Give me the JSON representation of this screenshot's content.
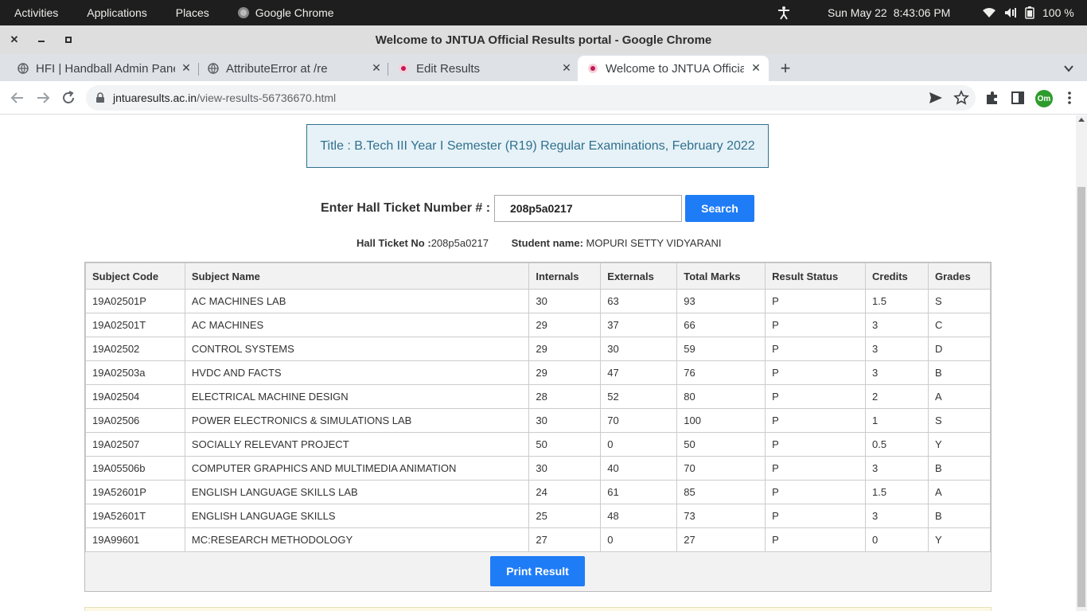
{
  "system_bar": {
    "activities": "Activities",
    "applications": "Applications",
    "places": "Places",
    "app_name": "Google Chrome",
    "date": "Sun May 22",
    "time": "8:43:06 PM",
    "battery": "100 %"
  },
  "window": {
    "title": "Welcome to JNTUA Official Results portal - Google Chrome"
  },
  "tabs": [
    {
      "label": "HFI | Handball Admin Panel",
      "active": false
    },
    {
      "label": "AttributeError at /re",
      "active": false
    },
    {
      "label": "Edit Results",
      "active": false
    },
    {
      "label": "Welcome to JNTUA Official Results portal",
      "active": true
    }
  ],
  "address_bar": {
    "domain": "jntuaresults.ac.in",
    "path": "/view-results-56736670.html"
  },
  "profile": {
    "initials": "Om",
    "color": "#2e9b2e"
  },
  "page": {
    "title": "Title : B.Tech III Year I Semester (R19) Regular Examinations, February 2022",
    "search_label": "Enter Hall Ticket Number # :",
    "search_value": "208p5a0217",
    "search_button": "Search",
    "hall_ticket_label": "Hall Ticket No :",
    "hall_ticket_value": "208p5a0217",
    "student_label": "Student name:",
    "student_value": "MOPURI SETTY VIDYARANI",
    "print_button": "Print Result",
    "accent_color": "#1f7cf7"
  },
  "results": {
    "headers": [
      "Subject Code",
      "Subject Name",
      "Internals",
      "Externals",
      "Total Marks",
      "Result Status",
      "Credits",
      "Grades"
    ],
    "rows": [
      [
        "19A02501P",
        "AC MACHINES LAB",
        "30",
        "63",
        "93",
        "P",
        "1.5",
        "S"
      ],
      [
        "19A02501T",
        "AC MACHINES",
        "29",
        "37",
        "66",
        "P",
        "3",
        "C"
      ],
      [
        "19A02502",
        "CONTROL SYSTEMS",
        "29",
        "30",
        "59",
        "P",
        "3",
        "D"
      ],
      [
        "19A02503a",
        "HVDC AND FACTS",
        "29",
        "47",
        "76",
        "P",
        "3",
        "B"
      ],
      [
        "19A02504",
        "ELECTRICAL MACHINE DESIGN",
        "28",
        "52",
        "80",
        "P",
        "2",
        "A"
      ],
      [
        "19A02506",
        "POWER ELECTRONICS & SIMULATIONS LAB",
        "30",
        "70",
        "100",
        "P",
        "1",
        "S"
      ],
      [
        "19A02507",
        "SOCIALLY RELEVANT PROJECT",
        "50",
        "0",
        "50",
        "P",
        "0.5",
        "Y"
      ],
      [
        "19A05506b",
        "COMPUTER GRAPHICS AND MULTIMEDIA ANIMATION",
        "30",
        "40",
        "70",
        "P",
        "3",
        "B"
      ],
      [
        "19A52601P",
        "ENGLISH LANGUAGE SKILLS LAB",
        "24",
        "61",
        "85",
        "P",
        "1.5",
        "A"
      ],
      [
        "19A52601T",
        "ENGLISH LANGUAGE SKILLS",
        "25",
        "48",
        "73",
        "P",
        "3",
        "B"
      ],
      [
        "19A99601",
        "MC:RESEARCH METHODOLOGY",
        "27",
        "0",
        "27",
        "P",
        "0",
        "Y"
      ]
    ]
  }
}
